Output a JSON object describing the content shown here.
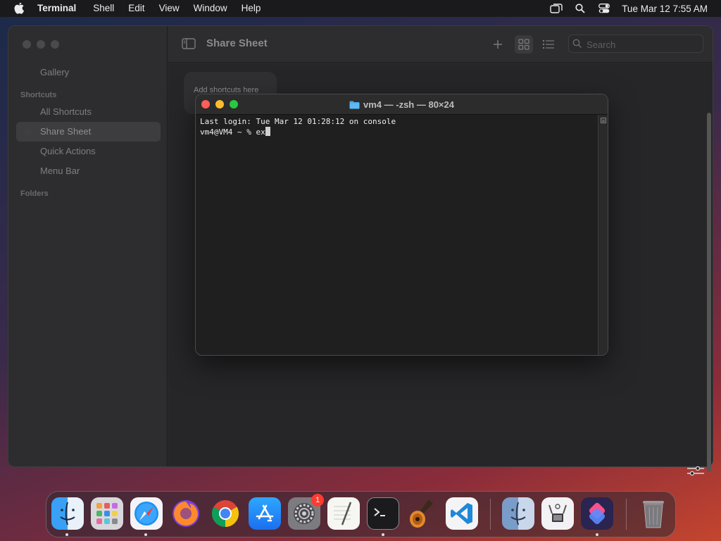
{
  "menubar": {
    "app_name": "Terminal",
    "menus": [
      "Shell",
      "Edit",
      "View",
      "Window",
      "Help"
    ],
    "status_icons": [
      "display-icon",
      "search-icon",
      "control-center-icon"
    ],
    "clock": "Tue Mar 12  7:55 AM"
  },
  "shortcuts_app": {
    "sidebar": {
      "gallery": "Gallery",
      "section_shortcuts": "Shortcuts",
      "items": [
        {
          "label": "All Shortcuts",
          "selected": false
        },
        {
          "label": "Share Sheet",
          "selected": true
        },
        {
          "label": "Quick Actions",
          "selected": false
        },
        {
          "label": "Menu Bar",
          "selected": false
        }
      ],
      "section_folders": "Folders"
    },
    "toolbar": {
      "title": "Share Sheet",
      "search_placeholder": "Search"
    },
    "content": {
      "tile_label": "Add shortcuts here"
    }
  },
  "terminal": {
    "title": "vm4 — -zsh — 80×24",
    "lines": [
      "Last login: Tue Mar 12 01:28:12 on console",
      "vm4@VM4 ~ % ex"
    ]
  },
  "dock": {
    "apps": [
      {
        "name": "Finder",
        "icon": "finder-icon",
        "running": true
      },
      {
        "name": "Launchpad",
        "icon": "launchpad-icon",
        "running": false
      },
      {
        "name": "Safari",
        "icon": "safari-icon",
        "running": true
      },
      {
        "name": "Firefox",
        "icon": "firefox-icon",
        "running": false
      },
      {
        "name": "Chrome",
        "icon": "chrome-icon",
        "running": false
      },
      {
        "name": "App Store",
        "icon": "app-store-icon",
        "running": false
      },
      {
        "name": "System Settings",
        "icon": "system-settings-icon",
        "running": false,
        "badge": "1"
      },
      {
        "name": "TextEdit",
        "icon": "textedit-icon",
        "running": false
      },
      {
        "name": "Terminal",
        "icon": "terminal-icon",
        "running": true
      },
      {
        "name": "GarageBand",
        "icon": "garageband-icon",
        "running": false
      },
      {
        "name": "VS Code",
        "icon": "vscode-icon",
        "running": false
      },
      {
        "name": "Migration Assistant",
        "icon": "migration-assistant-icon",
        "running": false
      },
      {
        "name": "System Information",
        "icon": "system-information-icon",
        "running": false
      },
      {
        "name": "Shortcuts",
        "icon": "shortcuts-icon",
        "running": true
      },
      {
        "name": "Trash",
        "icon": "trash-icon",
        "running": false
      }
    ]
  }
}
